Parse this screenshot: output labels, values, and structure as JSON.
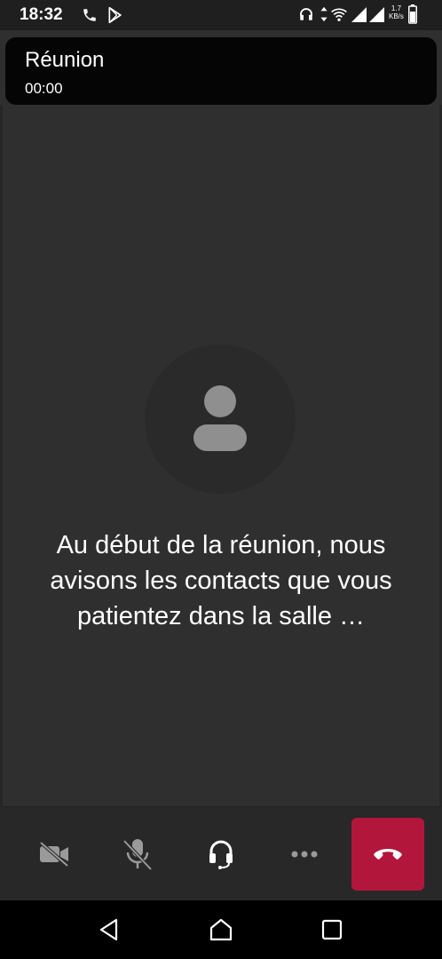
{
  "status_bar": {
    "time": "18:32",
    "left_icons": [
      "phone-icon",
      "play-store-icon"
    ],
    "right_icons": [
      "headset-icon",
      "data-arrows-icon",
      "wifi-icon",
      "signal-icon",
      "signal-icon",
      "battery-icon"
    ],
    "speed_value": "1.7",
    "speed_unit": "KB/s"
  },
  "header": {
    "title": "Réunion",
    "timer": "00:00"
  },
  "main": {
    "avatar_icon": "person-icon",
    "message": "Au début de la réunion, nous avisons les contacts que vous patientez dans la salle …"
  },
  "toolbar": {
    "buttons": [
      {
        "name": "camera-off-button",
        "icon": "video-off-icon"
      },
      {
        "name": "mic-off-button",
        "icon": "mic-off-icon"
      },
      {
        "name": "audio-button",
        "icon": "headset-icon"
      },
      {
        "name": "more-button",
        "icon": "more-dots-icon"
      },
      {
        "name": "hang-up-button",
        "icon": "phone-hangup-icon"
      }
    ],
    "hangup_color": "#b2163b"
  },
  "nav_bar": {
    "buttons": [
      "back-icon",
      "home-icon",
      "recents-icon"
    ]
  }
}
